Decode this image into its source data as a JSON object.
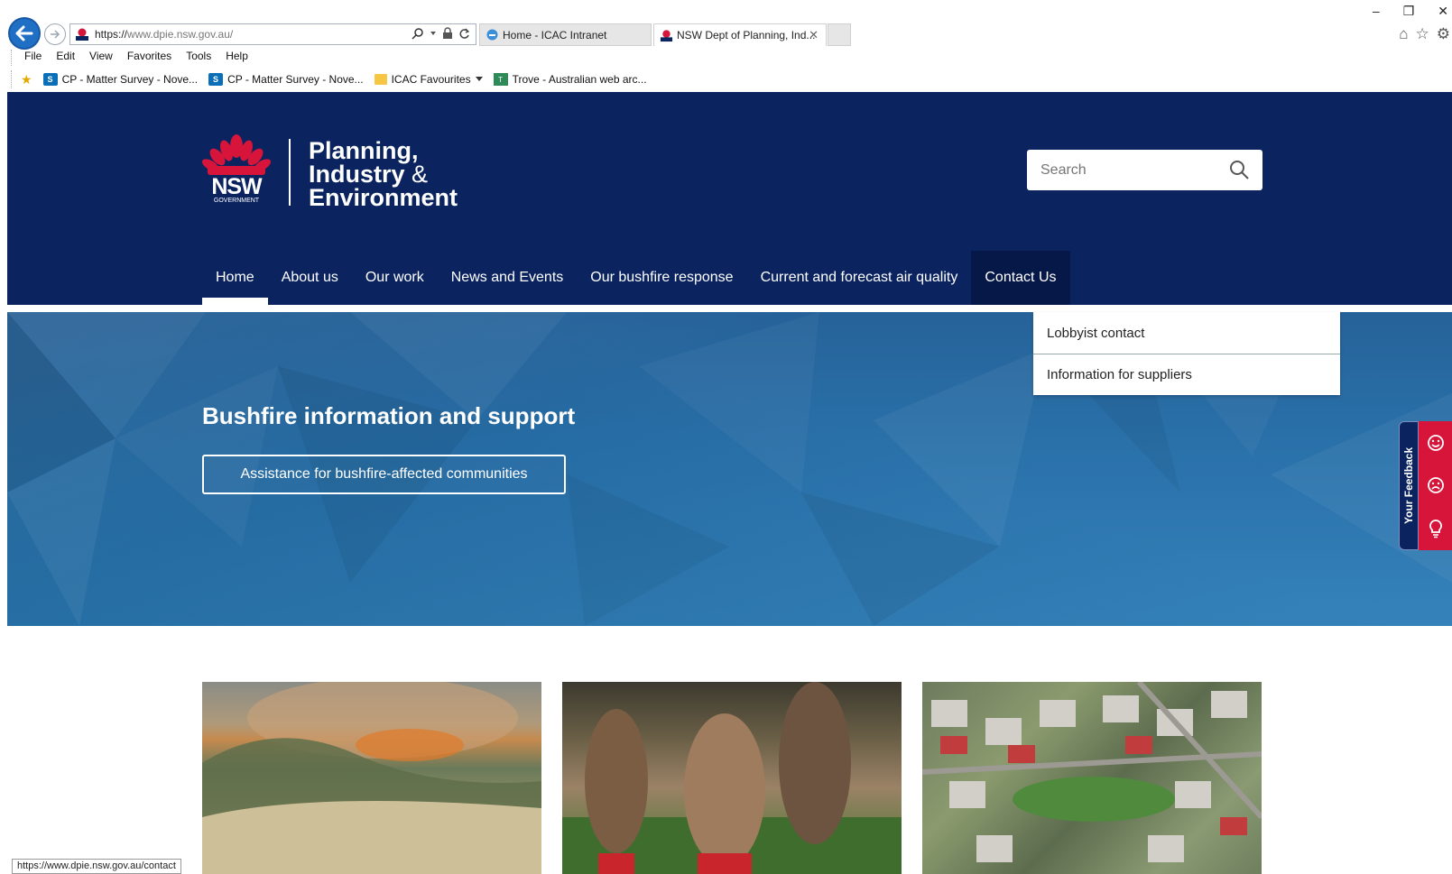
{
  "browser": {
    "address_scheme": "https://",
    "address_host": "www.dpie.nsw.gov.au",
    "address_path": "/",
    "tabs": [
      {
        "label": "Home - ICAC Intranet"
      },
      {
        "label": "NSW Dept of Planning, Ind..."
      }
    ],
    "menu": [
      "File",
      "Edit",
      "View",
      "Favorites",
      "Tools",
      "Help"
    ],
    "favorites": [
      {
        "label": "CP - Matter Survey - Nove..."
      },
      {
        "label": "CP - Matter Survey - Nove..."
      },
      {
        "label": "ICAC Favourites"
      },
      {
        "label": "Trove - Australian web arc..."
      }
    ],
    "status_url": "https://www.dpie.nsw.gov.au/contact"
  },
  "site": {
    "logo_text": "NSW",
    "logo_subtext": "GOVERNMENT",
    "dept_line1": "Planning,",
    "dept_line2": "Industry",
    "dept_amp": "&",
    "dept_line3": "Environment",
    "search_placeholder": "Search",
    "nav": [
      {
        "label": "Home"
      },
      {
        "label": "About us"
      },
      {
        "label": "Our work"
      },
      {
        "label": "News and Events"
      },
      {
        "label": "Our bushfire response"
      },
      {
        "label": "Current and forecast air quality"
      },
      {
        "label": "Contact Us"
      }
    ],
    "dropdown": [
      {
        "label": "Lobbyist contact"
      },
      {
        "label": "Information for suppliers"
      }
    ],
    "hero_title": "Bushfire information and support",
    "hero_button": "Assistance for bushfire-affected communities",
    "feedback_label": "Your Feedback"
  },
  "colors": {
    "header_bg": "#0b2460",
    "accent_red": "#d7153a",
    "hero_blue": "#1f6aa6"
  }
}
